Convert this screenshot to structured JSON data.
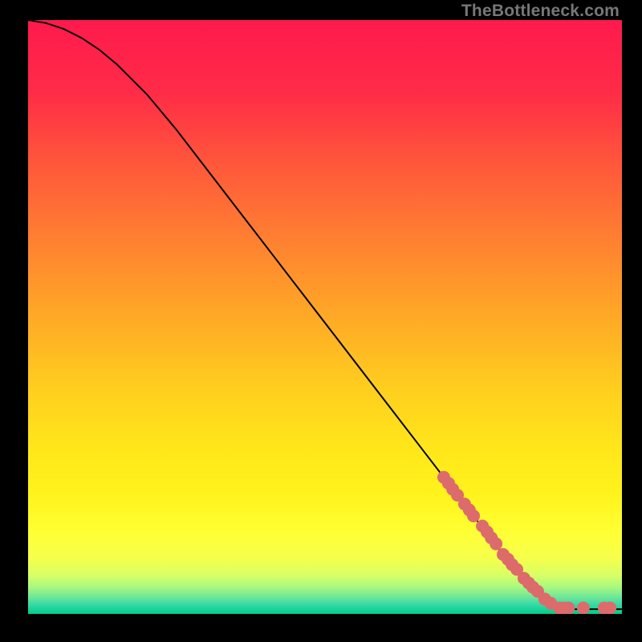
{
  "watermark": "TheBottleneck.com",
  "chart_data": {
    "type": "line",
    "title": "",
    "xlabel": "",
    "ylabel": "",
    "xlim": [
      0,
      100
    ],
    "ylim": [
      0,
      100
    ],
    "grid": false,
    "series": [
      {
        "name": "curve",
        "color": "#000000",
        "x": [
          0,
          3,
          6,
          9,
          12,
          15,
          20,
          25,
          30,
          35,
          40,
          45,
          50,
          55,
          60,
          65,
          70,
          75,
          80,
          82,
          84,
          86,
          88,
          90,
          92,
          94,
          96,
          98,
          100
        ],
        "y": [
          100,
          99.5,
          98.5,
          97,
          95,
          92.5,
          87.5,
          81.5,
          75,
          68.5,
          62,
          55.5,
          49,
          42.5,
          36,
          29.5,
          23,
          16.5,
          10,
          7.5,
          5.2,
          3.2,
          1.8,
          1.0,
          0.8,
          0.8,
          0.8,
          0.8,
          0.8
        ]
      }
    ],
    "markers": [
      {
        "name": "points",
        "color": "#dd6b6b",
        "radius": 8,
        "x": [
          70.0,
          70.8,
          71.5,
          72.3,
          73.5,
          74.3,
          75.0,
          76.5,
          77.3,
          78.0,
          78.8,
          80.0,
          80.8,
          81.5,
          82.3,
          83.5,
          84.3,
          85.0,
          85.8,
          87.0,
          88.0,
          89.5,
          90.2,
          91.0,
          93.5,
          97.0,
          98.0
        ],
        "y": [
          23.0,
          22.0,
          21.0,
          20.0,
          18.5,
          17.5,
          16.5,
          14.8,
          13.8,
          12.8,
          11.8,
          10.0,
          9.2,
          8.3,
          7.5,
          6.0,
          5.2,
          4.5,
          3.8,
          2.5,
          1.8,
          1.0,
          1.0,
          1.0,
          1.0,
          1.0,
          1.0
        ]
      }
    ],
    "gradient_stops": [
      {
        "offset": 0.0,
        "color": "#ff1a4d"
      },
      {
        "offset": 0.12,
        "color": "#ff2b47"
      },
      {
        "offset": 0.25,
        "color": "#ff5a3a"
      },
      {
        "offset": 0.38,
        "color": "#ff8330"
      },
      {
        "offset": 0.5,
        "color": "#ffa926"
      },
      {
        "offset": 0.62,
        "color": "#ffce1e"
      },
      {
        "offset": 0.72,
        "color": "#ffe61a"
      },
      {
        "offset": 0.8,
        "color": "#fff31c"
      },
      {
        "offset": 0.86,
        "color": "#ffff33"
      },
      {
        "offset": 0.905,
        "color": "#f6ff4a"
      },
      {
        "offset": 0.935,
        "color": "#d8ff66"
      },
      {
        "offset": 0.955,
        "color": "#a8f880"
      },
      {
        "offset": 0.972,
        "color": "#6de699"
      },
      {
        "offset": 0.985,
        "color": "#33d9a6"
      },
      {
        "offset": 1.0,
        "color": "#00cc88"
      }
    ]
  }
}
